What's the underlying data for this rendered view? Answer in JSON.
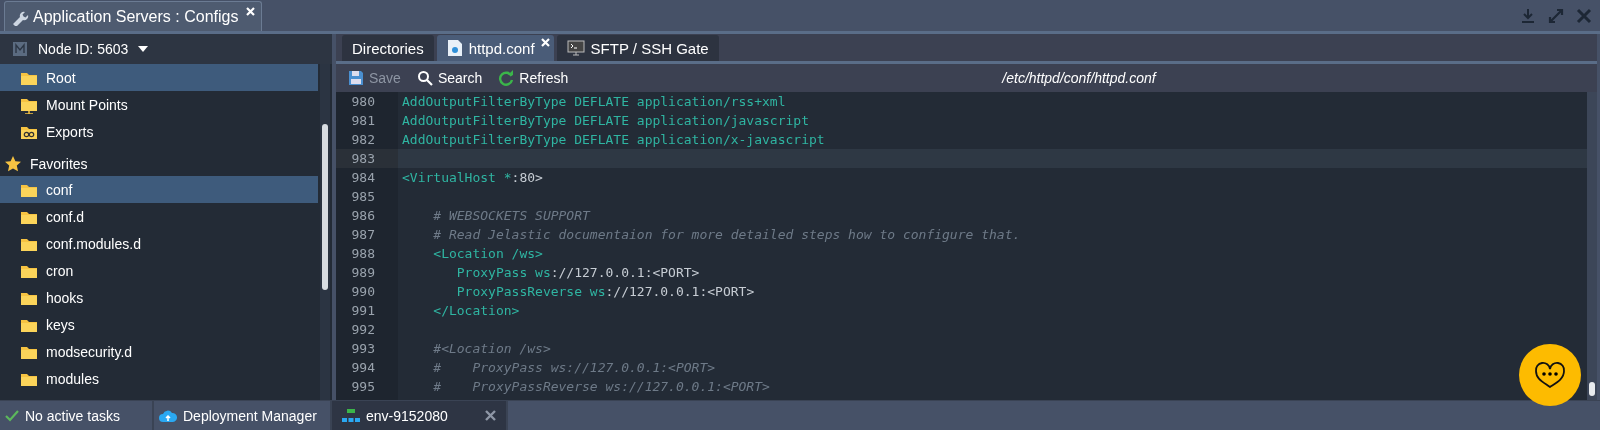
{
  "window": {
    "title": "Application Servers : Configs"
  },
  "node_selector": {
    "label": "Node ID: 5603"
  },
  "tree": [
    {
      "label": "Root",
      "kind": "folder",
      "selected": true
    },
    {
      "label": "Mount Points",
      "kind": "mount",
      "selected": false
    },
    {
      "label": "Exports",
      "kind": "exports",
      "selected": false
    },
    {
      "label": "Favorites",
      "kind": "favorites",
      "selected": false,
      "children": [
        {
          "label": "conf",
          "kind": "folder",
          "selected": true
        },
        {
          "label": "conf.d",
          "kind": "folder",
          "selected": false
        },
        {
          "label": "conf.modules.d",
          "kind": "folder",
          "selected": false
        },
        {
          "label": "cron",
          "kind": "folder",
          "selected": false
        },
        {
          "label": "hooks",
          "kind": "folder",
          "selected": false
        },
        {
          "label": "keys",
          "kind": "folder",
          "selected": false
        },
        {
          "label": "modsecurity.d",
          "kind": "folder",
          "selected": false
        },
        {
          "label": "modules",
          "kind": "folder",
          "selected": false
        }
      ]
    }
  ],
  "tabs": [
    {
      "label": "Directories",
      "kind": "plain",
      "selected": false
    },
    {
      "label": "httpd.conf",
      "kind": "file",
      "selected": true
    },
    {
      "label": "SFTP / SSH Gate",
      "kind": "terminal",
      "selected": false
    }
  ],
  "toolbar": [
    {
      "label": "Save",
      "kind": "save",
      "disabled": true
    },
    {
      "label": "Search",
      "kind": "search",
      "disabled": false
    },
    {
      "label": "Refresh",
      "kind": "refresh",
      "disabled": false
    }
  ],
  "file_path": "/etc/httpd/conf/httpd.conf",
  "code_lines": [
    {
      "number": "980",
      "selected": false,
      "tokens": [
        {
          "kind": "key",
          "text": "AddOutputFilterByType DEFLATE application/rss+xml"
        }
      ]
    },
    {
      "number": "981",
      "selected": false,
      "tokens": [
        {
          "kind": "key",
          "text": "AddOutputFilterByType DEFLATE application/javascript"
        }
      ]
    },
    {
      "number": "982",
      "selected": false,
      "tokens": [
        {
          "kind": "key",
          "text": "AddOutputFilterByType DEFLATE application/x-javascript"
        }
      ]
    },
    {
      "number": "983",
      "selected": true
    },
    {
      "number": "984",
      "selected": false,
      "tokens": [
        {
          "kind": "key",
          "text": "<VirtualHost *"
        },
        {
          "kind": "plain",
          "text": ":80>"
        }
      ]
    },
    {
      "number": "985",
      "selected": false
    },
    {
      "number": "986",
      "selected": false,
      "tokens": [
        {
          "kind": "comment",
          "text": "    # WEBSOCKETS SUPPORT"
        }
      ]
    },
    {
      "number": "987",
      "selected": false,
      "tokens": [
        {
          "kind": "comment",
          "text": "    # Read Jelastic documentaion for more detailed steps how to configure that."
        }
      ]
    },
    {
      "number": "988",
      "selected": false,
      "tokens": [
        {
          "kind": "key",
          "text": "    <Location /ws>"
        }
      ]
    },
    {
      "number": "989",
      "selected": false,
      "tokens": [
        {
          "kind": "key",
          "text": "       ProxyPass ws"
        },
        {
          "kind": "plain",
          "text": "://127.0.0.1:<PORT>"
        }
      ]
    },
    {
      "number": "990",
      "selected": false,
      "tokens": [
        {
          "kind": "key",
          "text": "       ProxyPassReverse ws"
        },
        {
          "kind": "plain",
          "text": "://127.0.0.1:<PORT>"
        }
      ]
    },
    {
      "number": "991",
      "selected": false,
      "tokens": [
        {
          "kind": "key",
          "text": "    </Location>"
        }
      ]
    },
    {
      "number": "992",
      "selected": false
    },
    {
      "number": "993",
      "selected": false,
      "tokens": [
        {
          "kind": "comment",
          "text": "    #<Location /ws>"
        }
      ]
    },
    {
      "number": "994",
      "selected": false,
      "tokens": [
        {
          "kind": "comment",
          "text": "    #    ProxyPass ws://127.0.0.1:<PORT>"
        }
      ]
    },
    {
      "number": "995",
      "selected": false,
      "tokens": [
        {
          "kind": "comment",
          "text": "    #    ProxyPassReverse ws://127.0.0.1:<PORT>"
        }
      ]
    }
  ],
  "status_bar": [
    {
      "label": "No active tasks",
      "kind": "tasks",
      "selected": false
    },
    {
      "label": "Deployment Manager",
      "kind": "cloud",
      "selected": false
    },
    {
      "label": "env-9152080",
      "kind": "env",
      "selected": true
    }
  ]
}
